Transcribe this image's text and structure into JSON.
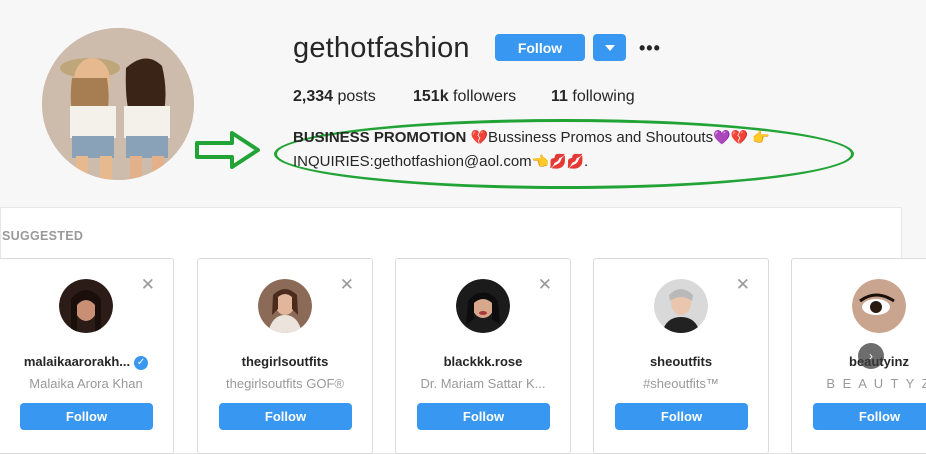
{
  "profile": {
    "username": "gethotfashion",
    "follow_label": "Follow",
    "dropdown_icon": "caret-down",
    "more_label": "•••",
    "stats": {
      "posts_count": "2,334",
      "posts_label": "posts",
      "followers_count": "151k",
      "followers_label": "followers",
      "following_count": "11",
      "following_label": "following"
    },
    "bio": {
      "line1_bold": "BUSINESS PROMOTION",
      "line1_heart": "💔",
      "line1_text": "Bussiness Promos and Shoutouts",
      "line1_purple": "💜",
      "line1_heart2": "💔",
      "line1_point": "👉",
      "line2_text": "INQUIRIES:gethotfashion@aol.com",
      "line2_point": "👈",
      "line2_lips": "💋💋",
      "line2_end": "."
    }
  },
  "suggested": {
    "title": "SUGGESTED",
    "close_label": "✕",
    "next_label": "›",
    "cards": [
      {
        "username": "malaikaarorakh...",
        "fullname": "Malaika Arora Khan",
        "verified": true,
        "verified_label": "✓",
        "follow": "Follow"
      },
      {
        "username": "thegirlsoutfits",
        "fullname": "thegirlsoutfits GOF®",
        "follow": "Follow"
      },
      {
        "username": "blackkk.rose",
        "fullname": "Dr. Mariam Sattar K...",
        "follow": "Follow"
      },
      {
        "username": "sheoutfits",
        "fullname": "#sheoutfits™",
        "follow": "Follow"
      },
      {
        "username": "beautyinz",
        "fullname": "B E A U T Y Z",
        "follow": "Follow"
      }
    ]
  },
  "colors": {
    "accent": "#3897f0",
    "annotation_green": "#21a336"
  }
}
